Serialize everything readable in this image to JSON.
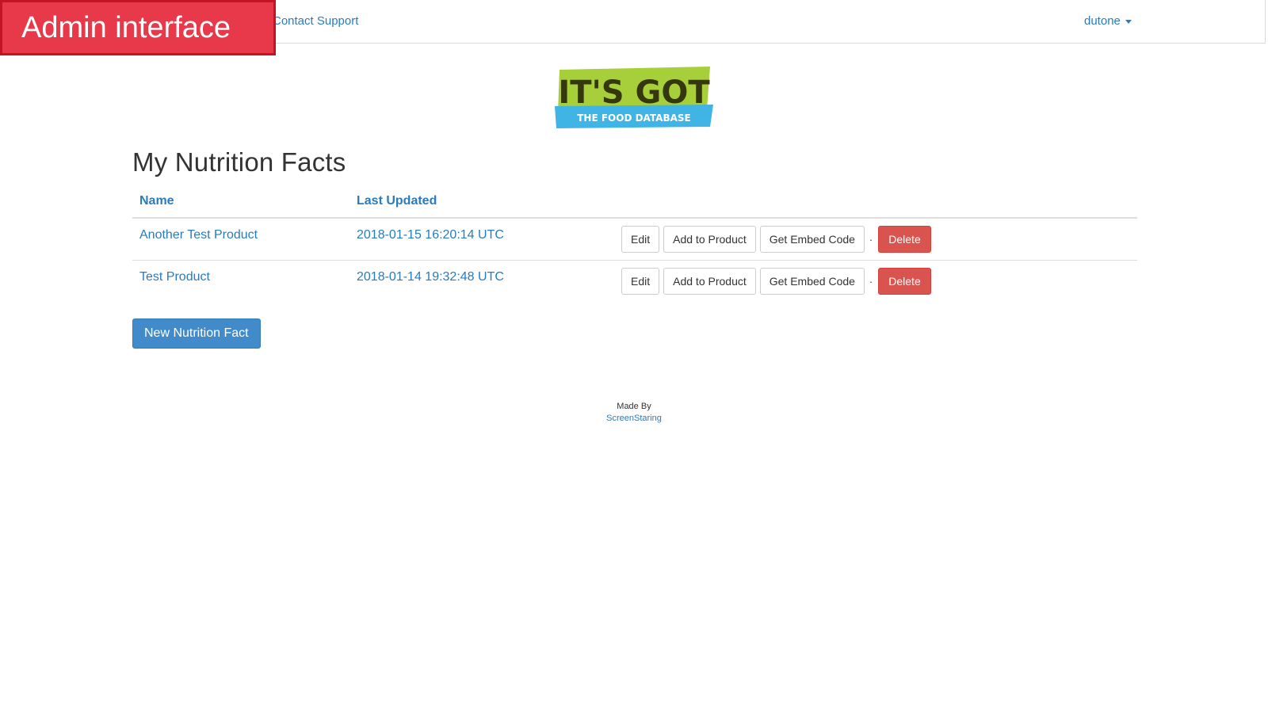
{
  "overlay": {
    "label": "Admin interface"
  },
  "navbar": {
    "contact_label": "Contact Support",
    "user_label": "dutone"
  },
  "logo": {
    "title": "IT'S GOT",
    "subtitle": "THE FOOD DATABASE",
    "colors": {
      "green": "#a7cf3a",
      "dark": "#35380f",
      "blue": "#3fb4e5"
    }
  },
  "page": {
    "title": "My Nutrition Facts"
  },
  "table": {
    "columns": [
      "Name",
      "Last Updated"
    ],
    "rows": [
      {
        "name": "Another Test Product",
        "updated": "2018-01-15 16:20:14 UTC",
        "actions": {
          "edit": "Edit",
          "add": "Add to Product",
          "embed": "Get Embed Code",
          "sep": "·",
          "delete": "Delete"
        }
      },
      {
        "name": "Test Product",
        "updated": "2018-01-14 19:32:48 UTC",
        "actions": {
          "edit": "Edit",
          "add": "Add to Product",
          "embed": "Get Embed Code",
          "sep": "·",
          "delete": "Delete"
        }
      }
    ]
  },
  "new_button": {
    "label": "New Nutrition Fact"
  },
  "footer": {
    "made_by": "Made By",
    "link": "ScreenStaring"
  },
  "colors": {
    "link": "#2a7bbd",
    "primary": "#428bca",
    "danger": "#d9534f",
    "overlay": "#e8394a"
  }
}
